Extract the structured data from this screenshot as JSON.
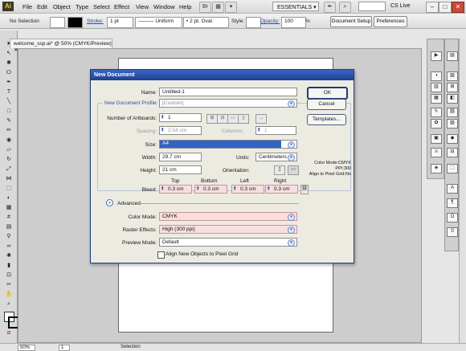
{
  "menubar": {
    "items": [
      "File",
      "Edit",
      "Object",
      "Type",
      "Select",
      "Effect",
      "View",
      "Window",
      "Help"
    ],
    "workspace": "ESSENTIALS",
    "cs_live": "CS Live"
  },
  "control_bar": {
    "selection_status": "No Selection",
    "stroke_label": "Stroke:",
    "stroke_value": "1 pt",
    "profile_value": "Uniform",
    "brush_value": "2 pt. Oval",
    "style_label": "Style:",
    "opacity_label": "Opacity:",
    "opacity_value": "100",
    "percent": "%",
    "doc_setup": "Document Setup",
    "preferences": "Preferences"
  },
  "document_tab": {
    "title": "welcome_ssp.ai* @ 50% (CMYK/Preview)"
  },
  "status_bar": {
    "zoom": "50%",
    "page": "1",
    "tool_status": "Selection"
  },
  "dialog": {
    "title": "New Document",
    "name_label": "Name:",
    "name_value": "Untitled-1",
    "profile_label": "New Document Profile:",
    "profile_value": "[Custom]",
    "artboards_label": "Number of Artboards:",
    "artboards_value": "1",
    "spacing_label": "Spacing:",
    "spacing_value": "2.54 cm",
    "columns_label": "Columns:",
    "columns_value": "1",
    "size_label": "Size:",
    "size_value": "A4",
    "width_label": "Width:",
    "width_value": "29.7 cm",
    "units_label": "Units:",
    "units_value": "Centimeters",
    "height_label": "Height:",
    "height_value": "21 cm",
    "orientation_label": "Orientation:",
    "bleed_label": "Bleed:",
    "bleed_headers": [
      "Top",
      "Bottom",
      "Left",
      "Right"
    ],
    "bleed_values": [
      "0.3 cm",
      "0.3 cm",
      "0.3 cm",
      "0.3 cm"
    ],
    "advanced_label": "Advanced",
    "color_mode_label": "Color Mode:",
    "color_mode_value": "CMYK",
    "raster_label": "Raster Effects:",
    "raster_value": "High (300 ppi)",
    "preview_label": "Preview Mode:",
    "preview_value": "Default",
    "align_label": "Align New Objects to Pixel Grid",
    "ok": "OK",
    "cancel": "Cancel",
    "templates": "Templates...",
    "info_color_mode": "Color Mode:CMYK",
    "info_ppi": "PPI:300",
    "info_align": "Align to Pixel Grid:No"
  },
  "colors": {
    "titlebar": "#2a4fa8",
    "highlight": "#3163c4",
    "bleed_bg": "#f8dede"
  }
}
